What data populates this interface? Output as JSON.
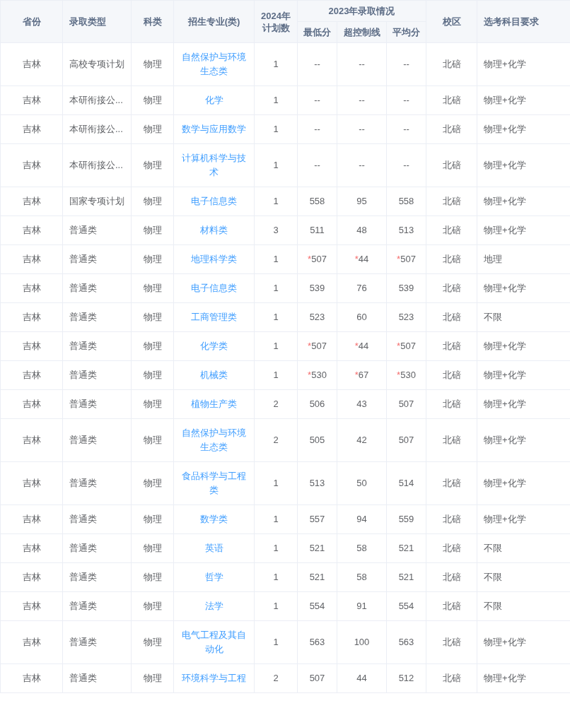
{
  "table": {
    "columns": [
      {
        "label": "省份"
      },
      {
        "label": "录取类型"
      },
      {
        "label": "科类"
      },
      {
        "label": "招生专业(类)"
      },
      {
        "label": "2024年计划数"
      },
      {
        "label": "2023年录取情况",
        "sub": [
          "最低分",
          "超控制线",
          "平均分"
        ]
      },
      {
        "label": "校区"
      },
      {
        "label": "选考科目要求"
      }
    ],
    "rows": [
      {
        "province": "吉林",
        "type": "高校专项计划",
        "category": "物理",
        "major": "自然保护与环境生态类",
        "plan": "1",
        "min": {
          "value": "--"
        },
        "over": {
          "value": "--"
        },
        "avg": {
          "value": "--"
        },
        "campus": "北碚",
        "subjects": "物理+化学"
      },
      {
        "province": "吉林",
        "type": "本研衔接公...",
        "category": "物理",
        "major": "化学",
        "plan": "1",
        "min": {
          "value": "--"
        },
        "over": {
          "value": "--"
        },
        "avg": {
          "value": "--"
        },
        "campus": "北碚",
        "subjects": "物理+化学"
      },
      {
        "province": "吉林",
        "type": "本研衔接公...",
        "category": "物理",
        "major": "数学与应用数学",
        "plan": "1",
        "min": {
          "value": "--"
        },
        "over": {
          "value": "--"
        },
        "avg": {
          "value": "--"
        },
        "campus": "北碚",
        "subjects": "物理+化学"
      },
      {
        "province": "吉林",
        "type": "本研衔接公...",
        "category": "物理",
        "major": "计算机科学与技术",
        "plan": "1",
        "min": {
          "value": "--"
        },
        "over": {
          "value": "--"
        },
        "avg": {
          "value": "--"
        },
        "campus": "北碚",
        "subjects": "物理+化学"
      },
      {
        "province": "吉林",
        "type": "国家专项计划",
        "category": "物理",
        "major": "电子信息类",
        "plan": "1",
        "min": {
          "value": "558"
        },
        "over": {
          "value": "95"
        },
        "avg": {
          "value": "558"
        },
        "campus": "北碚",
        "subjects": "物理+化学"
      },
      {
        "province": "吉林",
        "type": "普通类",
        "category": "物理",
        "major": "材料类",
        "plan": "3",
        "min": {
          "value": "511"
        },
        "over": {
          "value": "48"
        },
        "avg": {
          "value": "513"
        },
        "campus": "北碚",
        "subjects": "物理+化学"
      },
      {
        "province": "吉林",
        "type": "普通类",
        "category": "物理",
        "major": "地理科学类",
        "plan": "1",
        "min": {
          "note": "*",
          "value": "507"
        },
        "over": {
          "note": "*",
          "value": "44"
        },
        "avg": {
          "note": "*",
          "value": "507"
        },
        "campus": "北碚",
        "subjects": "地理"
      },
      {
        "province": "吉林",
        "type": "普通类",
        "category": "物理",
        "major": "电子信息类",
        "plan": "1",
        "min": {
          "value": "539"
        },
        "over": {
          "value": "76"
        },
        "avg": {
          "value": "539"
        },
        "campus": "北碚",
        "subjects": "物理+化学"
      },
      {
        "province": "吉林",
        "type": "普通类",
        "category": "物理",
        "major": "工商管理类",
        "plan": "1",
        "min": {
          "value": "523"
        },
        "over": {
          "value": "60"
        },
        "avg": {
          "value": "523"
        },
        "campus": "北碚",
        "subjects": "不限"
      },
      {
        "province": "吉林",
        "type": "普通类",
        "category": "物理",
        "major": "化学类",
        "plan": "1",
        "min": {
          "note": "*",
          "value": "507"
        },
        "over": {
          "note": "*",
          "value": "44"
        },
        "avg": {
          "note": "*",
          "value": "507"
        },
        "campus": "北碚",
        "subjects": "物理+化学"
      },
      {
        "province": "吉林",
        "type": "普通类",
        "category": "物理",
        "major": "机械类",
        "plan": "1",
        "min": {
          "note": "*",
          "value": "530"
        },
        "over": {
          "note": "*",
          "value": "67"
        },
        "avg": {
          "note": "*",
          "value": "530"
        },
        "campus": "北碚",
        "subjects": "物理+化学"
      },
      {
        "province": "吉林",
        "type": "普通类",
        "category": "物理",
        "major": "植物生产类",
        "plan": "2",
        "min": {
          "value": "506"
        },
        "over": {
          "value": "43"
        },
        "avg": {
          "value": "507"
        },
        "campus": "北碚",
        "subjects": "物理+化学"
      },
      {
        "province": "吉林",
        "type": "普通类",
        "category": "物理",
        "major": "自然保护与环境生态类",
        "plan": "2",
        "min": {
          "value": "505"
        },
        "over": {
          "value": "42"
        },
        "avg": {
          "value": "507"
        },
        "campus": "北碚",
        "subjects": "物理+化学"
      },
      {
        "province": "吉林",
        "type": "普通类",
        "category": "物理",
        "major": "食品科学与工程类",
        "plan": "1",
        "min": {
          "value": "513"
        },
        "over": {
          "value": "50"
        },
        "avg": {
          "value": "514"
        },
        "campus": "北碚",
        "subjects": "物理+化学"
      },
      {
        "province": "吉林",
        "type": "普通类",
        "category": "物理",
        "major": "数学类",
        "plan": "1",
        "min": {
          "value": "557"
        },
        "over": {
          "value": "94"
        },
        "avg": {
          "value": "559"
        },
        "campus": "北碚",
        "subjects": "物理+化学"
      },
      {
        "province": "吉林",
        "type": "普通类",
        "category": "物理",
        "major": "英语",
        "plan": "1",
        "min": {
          "value": "521"
        },
        "over": {
          "value": "58"
        },
        "avg": {
          "value": "521"
        },
        "campus": "北碚",
        "subjects": "不限"
      },
      {
        "province": "吉林",
        "type": "普通类",
        "category": "物理",
        "major": "哲学",
        "plan": "1",
        "min": {
          "value": "521"
        },
        "over": {
          "value": "58"
        },
        "avg": {
          "value": "521"
        },
        "campus": "北碚",
        "subjects": "不限"
      },
      {
        "province": "吉林",
        "type": "普通类",
        "category": "物理",
        "major": "法学",
        "plan": "1",
        "min": {
          "value": "554"
        },
        "over": {
          "value": "91"
        },
        "avg": {
          "value": "554"
        },
        "campus": "北碚",
        "subjects": "不限"
      },
      {
        "province": "吉林",
        "type": "普通类",
        "category": "物理",
        "major": "电气工程及其自动化",
        "plan": "1",
        "min": {
          "value": "563"
        },
        "over": {
          "value": "100"
        },
        "avg": {
          "value": "563"
        },
        "campus": "北碚",
        "subjects": "物理+化学"
      },
      {
        "province": "吉林",
        "type": "普通类",
        "category": "物理",
        "major": "环境科学与工程",
        "plan": "2",
        "min": {
          "value": "507"
        },
        "over": {
          "value": "44"
        },
        "avg": {
          "value": "512"
        },
        "campus": "北碚",
        "subjects": "物理+化学"
      }
    ]
  }
}
